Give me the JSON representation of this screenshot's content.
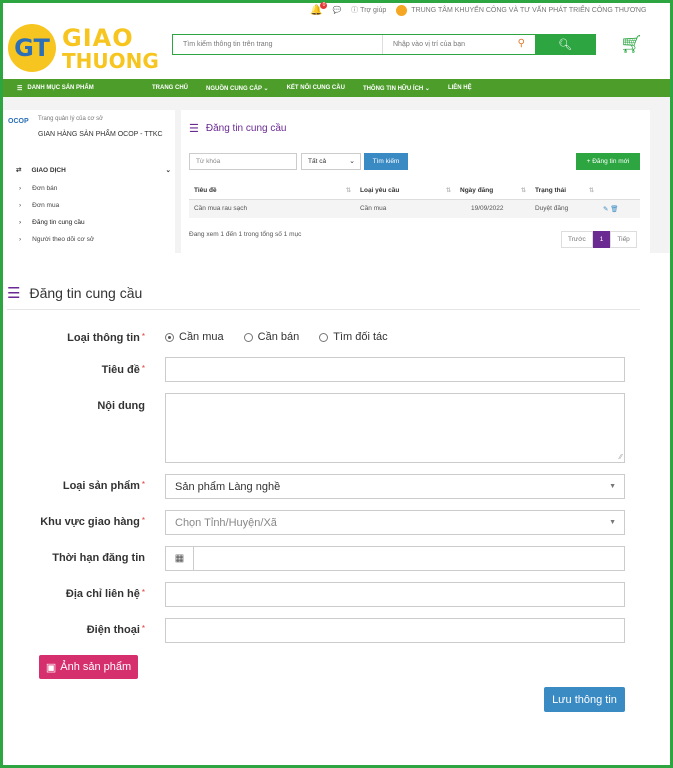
{
  "topbar": {
    "notif_count": "0",
    "help": "Trợ giúp",
    "center_name": "TRUNG TÂM KHUYẾN CÔNG VÀ TƯ VẤN PHÁT TRIỂN CÔNG THƯƠNG"
  },
  "logo": {
    "mark": "GT",
    "line1": "GIAO",
    "line2": "THUONG"
  },
  "search": {
    "keyword_placeholder": "Tìm kiếm thông tin trên trang",
    "location_placeholder": "Nhập vào vị trí của bạn"
  },
  "nav": {
    "category": "DANH MỤC SẢN PHẨM",
    "items": [
      {
        "label": "TRANG CHỦ"
      },
      {
        "label": "NGUỒN CUNG CẤP ⌄"
      },
      {
        "label": "KẾT NỐI CUNG CẦU"
      },
      {
        "label": "THÔNG TIN HỮU ÍCH ⌄"
      },
      {
        "label": "LIÊN HỆ"
      }
    ]
  },
  "sidebar": {
    "logo": "OCOP",
    "subtitle": "Trang quản lý của cơ sở",
    "shop_name": "GIAN HÀNG SẢN PHẨM OCOP - TTKC",
    "section": "GIAO DỊCH",
    "items": [
      {
        "label": "Đơn bán"
      },
      {
        "label": "Đơn mua"
      },
      {
        "label": "Đăng tin cung cầu"
      },
      {
        "label": "Người theo dõi cơ sở"
      }
    ]
  },
  "listing": {
    "title": "Đăng tin cung cầu",
    "keyword_placeholder": "Từ khóa",
    "filter_value": "Tất cả",
    "search_btn": "Tìm kiếm",
    "new_btn": "+ Đăng tin mới",
    "columns": [
      "Tiêu đề",
      "Loại yêu cầu",
      "Ngày đăng",
      "Trạng thái"
    ],
    "rows": [
      {
        "title": "Cần mua rau sạch",
        "type": "Cần mua",
        "date": "19/09/2022",
        "status": "Duyệt đăng"
      }
    ],
    "info": "Đang xem 1 đến 1 trong tổng số 1 mục",
    "prev": "Trước",
    "page": "1",
    "next": "Tiếp"
  },
  "form": {
    "title": "Đăng tin cung cầu",
    "type_label": "Loại thông tin",
    "type_options": [
      "Cần mua",
      "Cần bán",
      "Tìm đối tác"
    ],
    "type_selected": "Cần mua",
    "title_label": "Tiêu đề",
    "content_label": "Nội dung",
    "product_type_label": "Loại sản phẩm",
    "product_type_value": "Sản phẩm Làng nghề",
    "area_label": "Khu vực giao hàng",
    "area_placeholder": "Chọn Tỉnh/Huyện/Xã",
    "duration_label": "Thời hạn đăng tin",
    "address_label": "Địa chỉ liên hệ",
    "phone_label": "Điện thoại",
    "photo_btn": "Ảnh sản phẩm",
    "save_btn": "Lưu thông tin"
  },
  "colors": {
    "green": "#2da642",
    "nav_green": "#4c9d2a",
    "purple": "#6a2a92",
    "blue": "#3a8ac4",
    "pink": "#d62f6e"
  }
}
